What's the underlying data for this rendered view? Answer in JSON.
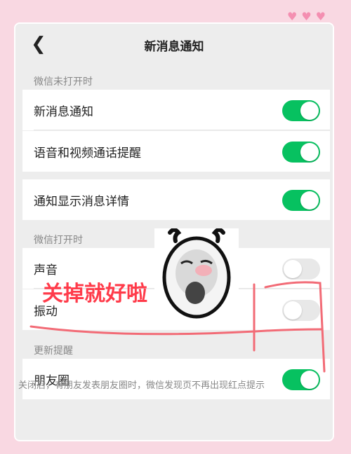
{
  "header": {
    "back_icon": "chevron-left-icon",
    "title": "新消息通知"
  },
  "sections": [
    {
      "label": "微信未打开时"
    },
    {
      "label": "微信打开时"
    },
    {
      "label": "更新提醒"
    }
  ],
  "rows": [
    {
      "label": "新消息通知",
      "on": true
    },
    {
      "label": "语音和视频通话提醒",
      "on": true
    },
    {
      "label": "通知显示消息详情",
      "on": true
    },
    {
      "label": "声音",
      "on": false
    },
    {
      "label": "振动",
      "on": false
    },
    {
      "label": "朋友圈",
      "on": true
    }
  ],
  "footer_note": "关闭后，有朋友发表朋友圈时，微信发现页不再出现红点提示",
  "annotation": {
    "text": "关掉就好啦"
  },
  "colors": {
    "accent": "#07c160",
    "annotation": "#ff3b4a",
    "background": "#f9d8e2"
  }
}
